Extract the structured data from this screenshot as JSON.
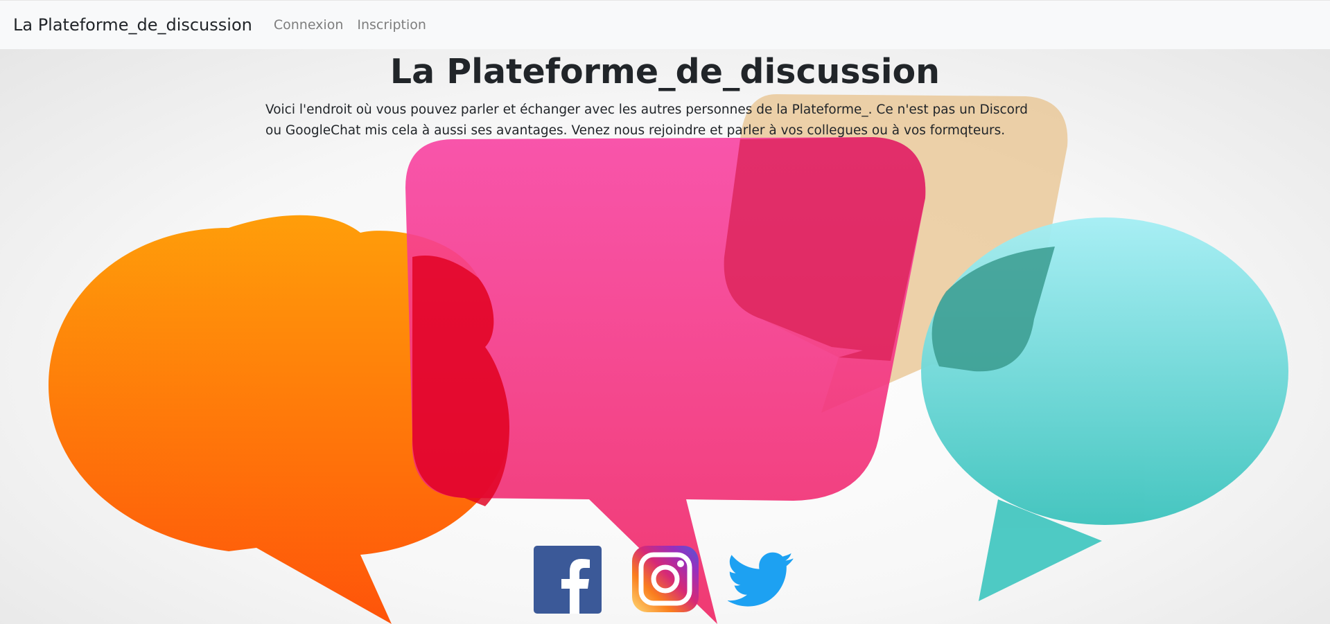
{
  "navbar": {
    "brand": "La Plateforme_de_discussion",
    "links": [
      "Connexion",
      "Inscription"
    ]
  },
  "hero": {
    "title": "La Plateforme_de_discussion",
    "intro": "Voici l'endroit où vous pouvez parler et échanger avec les autres personnes de la Plateforme_. Ce n'est pas un Discord ou GoogleChat mis cela à aussi ses avantages. Venez nous rejoindre et parler à vos collegues ou à vos formqteurs."
  },
  "social": [
    {
      "name": "facebook-icon",
      "color": "#3b5998"
    },
    {
      "name": "instagram-icon",
      "color": "#c13584"
    },
    {
      "name": "twitter-icon",
      "color": "#1da1f2"
    }
  ],
  "colors": {
    "orange_bubble": "#ff6a00",
    "pink_bubble": "#f2237a",
    "tan_bubble": "#e8c189",
    "teal_bubble": "#4fd0d3"
  }
}
